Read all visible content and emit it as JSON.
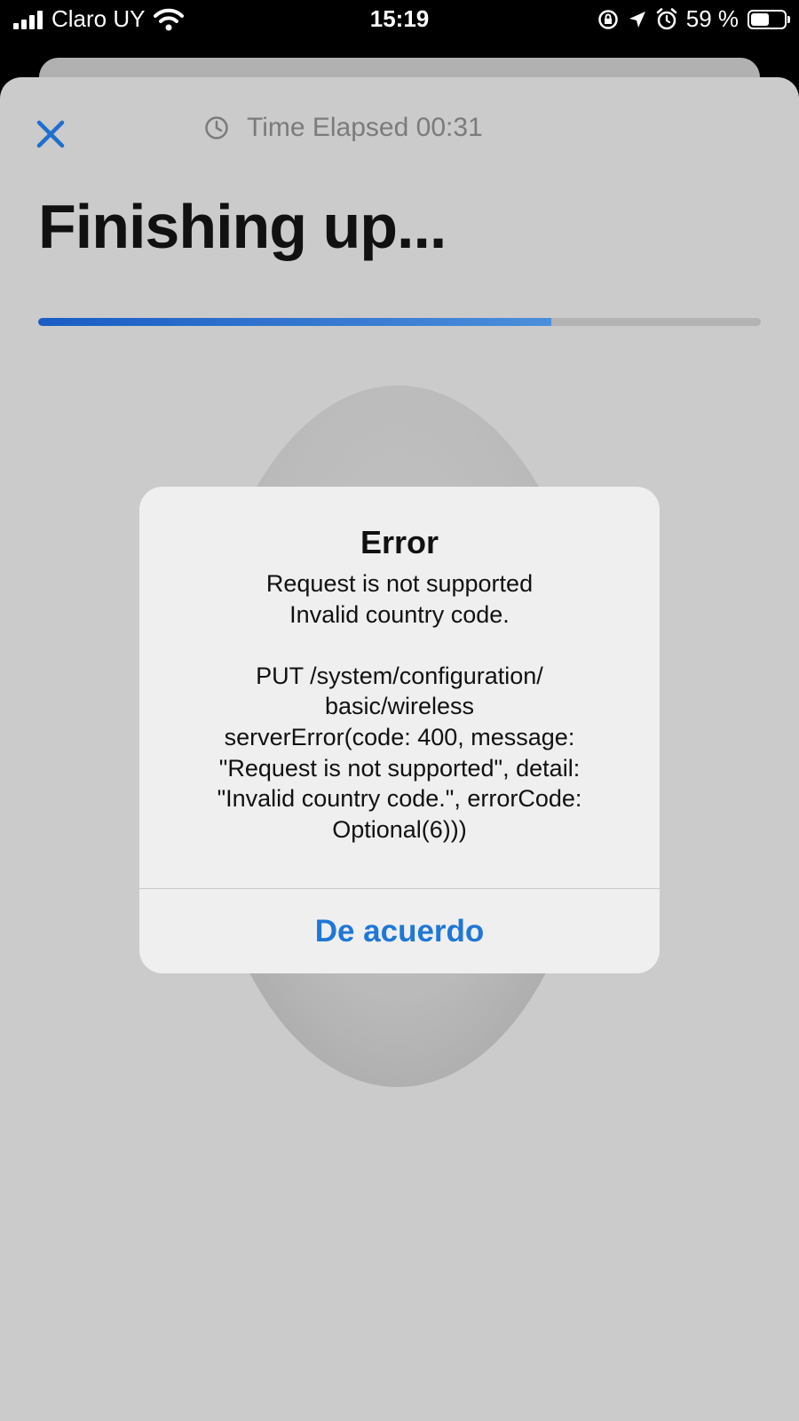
{
  "status_bar": {
    "carrier": "Claro UY",
    "time": "15:19",
    "battery_percent": "59 %",
    "battery_level": 0.59,
    "icons": [
      "signal-icon",
      "wifi-icon",
      "orientation-lock-icon",
      "location-icon",
      "alarm-icon",
      "battery-icon"
    ]
  },
  "header": {
    "close_icon": "close-icon",
    "timer_icon": "clock-icon",
    "timer_text": "Time Elapsed 00:31"
  },
  "main": {
    "title": "Finishing up...",
    "progress": 0.71
  },
  "alert": {
    "title": "Error",
    "message": "Request is not supported\nInvalid country code.\n\nPUT /system/configuration/\nbasic/wireless\nserverError(code: 400, message:\n\"Request is not supported\", detail:\n\"Invalid country code.\", errorCode:\nOptional(6)))",
    "button_label": "De acuerdo"
  },
  "colors": {
    "accent": "#1f77d6",
    "progress": "#1a5cc4",
    "sheet_background": "#cbcbcb",
    "alert_background": "#efefef"
  }
}
